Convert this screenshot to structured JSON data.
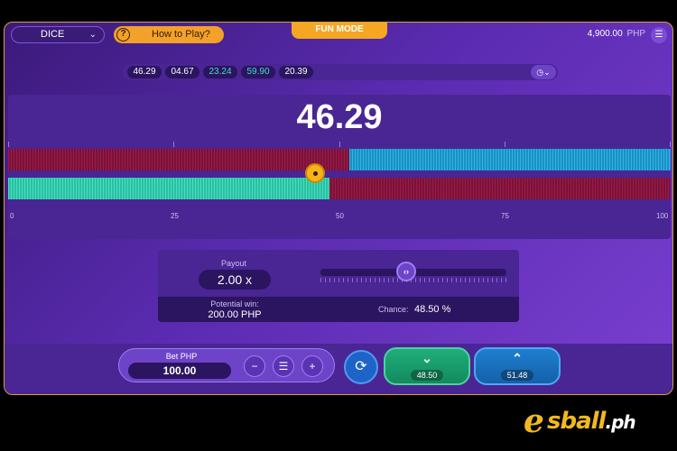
{
  "header": {
    "game_select": "DICE",
    "how_to_play": "How to Play?",
    "mode_badge": "FUN MODE",
    "balance": "4,900.00",
    "currency": "PHP"
  },
  "history": [
    "46.29",
    "04.67",
    "23.24",
    "59.90",
    "20.39"
  ],
  "history_colors": [
    "#ffffff",
    "#ffffff",
    "#43e0c0",
    "#43e0c0",
    "#ffffff"
  ],
  "result": {
    "value": "46.29",
    "marker_value": 46.29,
    "over_threshold": 51.48,
    "under_threshold": 48.5
  },
  "axis": {
    "ticks": [
      "0",
      "25",
      "50",
      "75",
      "100"
    ]
  },
  "payout": {
    "label": "Payout",
    "value": "2.00 x",
    "slider_value": 48.5,
    "potential_label": "Potential win:",
    "potential_value": "200.00 PHP",
    "chance_label": "Chance:",
    "chance_value": "48.50 %"
  },
  "bet": {
    "label": "Bet PHP",
    "amount": "100.00",
    "under_value": "48.50",
    "over_value": "51.48"
  },
  "colors": {
    "accent": "#f5a623",
    "under": "#1fae7a",
    "over": "#1e7fd0",
    "losing_segment": "#9c1b4a"
  },
  "watermark": "esball.ph"
}
